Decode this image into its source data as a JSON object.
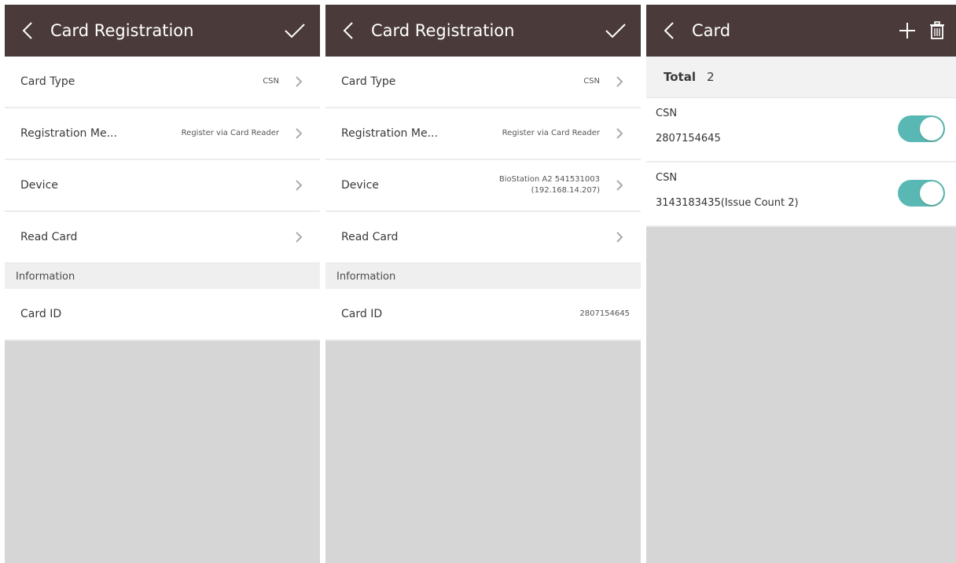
{
  "colors": {
    "titlebar": "#4a3a3a",
    "background": "#d6d6d6",
    "section": "#efefef",
    "toggle_on": "#59b8b3"
  },
  "screen1": {
    "title": "Card Registration",
    "back_icon": "chevron-left-icon",
    "action_icon": "check-icon",
    "rows": [
      {
        "label": "Card Type",
        "value": "CSN"
      },
      {
        "label": "Registration Me...",
        "value": "Register via Card Reader"
      },
      {
        "label": "Device",
        "value": ""
      },
      {
        "label": "Read Card",
        "value": ""
      }
    ],
    "section_label": "Information",
    "card_id_label": "Card ID",
    "card_id_value": ""
  },
  "screen2": {
    "title": "Card Registration",
    "back_icon": "chevron-left-icon",
    "action_icon": "check-icon",
    "rows": [
      {
        "label": "Card Type",
        "value": "CSN"
      },
      {
        "label": "Registration Me...",
        "value": "Register via Card Reader"
      },
      {
        "label": "Device",
        "value_line1": "BioStation A2 541531003",
        "value_line2": "(192.168.14.207)"
      },
      {
        "label": "Read Card",
        "value": ""
      }
    ],
    "section_label": "Information",
    "card_id_label": "Card ID",
    "card_id_value": "2807154645"
  },
  "screen3": {
    "title": "Card",
    "back_icon": "chevron-left-icon",
    "add_icon": "plus-icon",
    "delete_icon": "trash-icon",
    "total_label": "Total",
    "total_value": "2",
    "cards": [
      {
        "type": "CSN",
        "id": "2807154645",
        "enabled": true
      },
      {
        "type": "CSN",
        "id": "3143183435(Issue Count 2)",
        "enabled": true
      }
    ]
  }
}
